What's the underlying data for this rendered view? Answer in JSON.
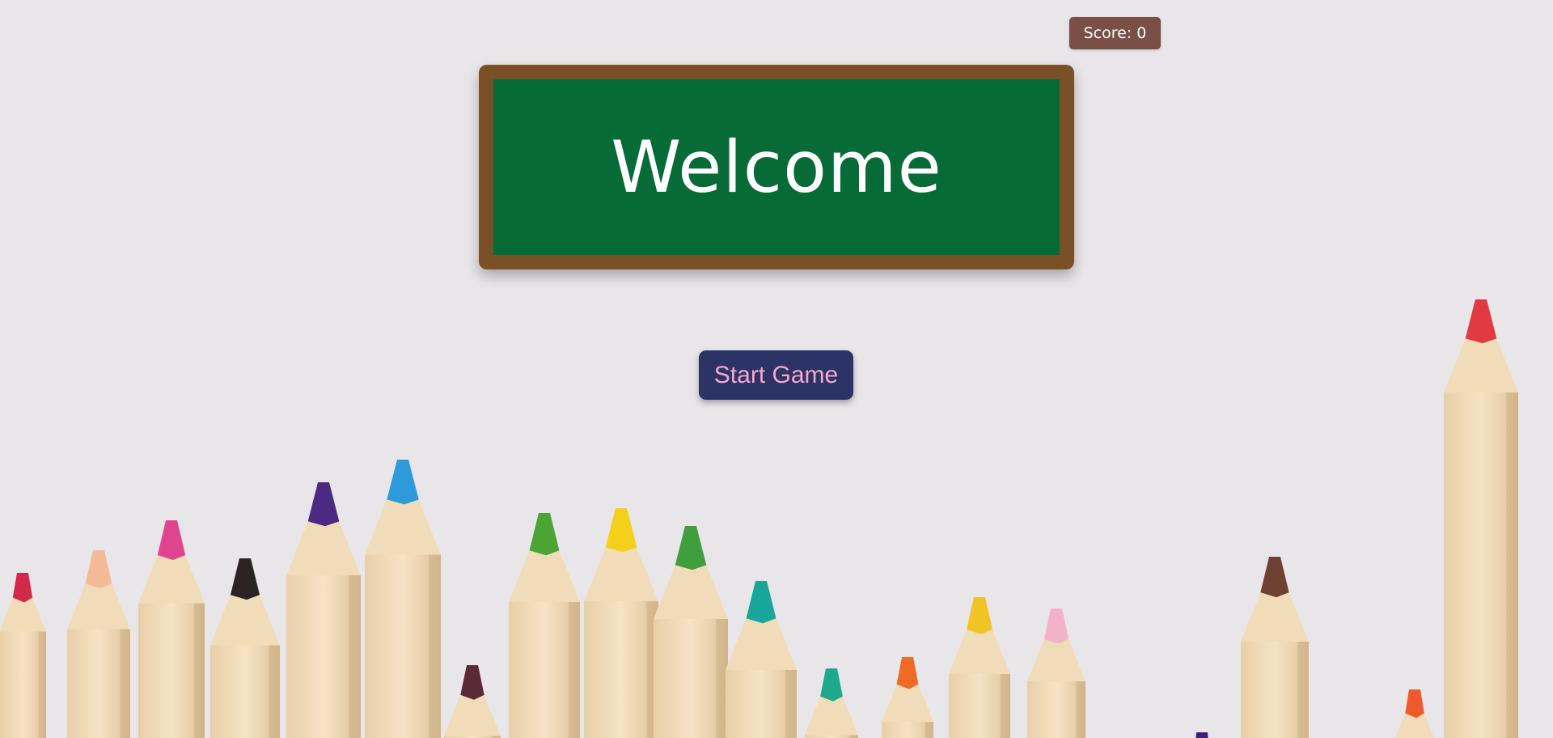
{
  "score": {
    "label": "Score: 0",
    "value": 0
  },
  "chalkboard": {
    "title": "Welcome"
  },
  "start_button": {
    "label": "Start Game"
  },
  "colors": {
    "page_background": "#e9e6ea",
    "score_badge": "#7a4f45",
    "chalkboard_frame": "#7a5027",
    "chalkboard_surface": "#066b36",
    "button_background": "#2c3366",
    "button_text": "#f7a8c8",
    "pencil_wood": "#f1dcb9"
  },
  "background": {
    "image": "colored-pencils-photo",
    "pencil_colors": [
      "#d1294b",
      "#f4b997",
      "#e0448d",
      "#2c2424",
      "#4d2a82",
      "#2d9bd9",
      "#5a2a36",
      "#4aa534",
      "#f3d01a",
      "#3f9f3f",
      "#18a59a",
      "#1fa98c",
      "#ee6a25",
      "#f0c425",
      "#f2b2c8",
      "#3a1e7a",
      "#6e4134",
      "#ee5a2c",
      "#e13a40"
    ]
  }
}
